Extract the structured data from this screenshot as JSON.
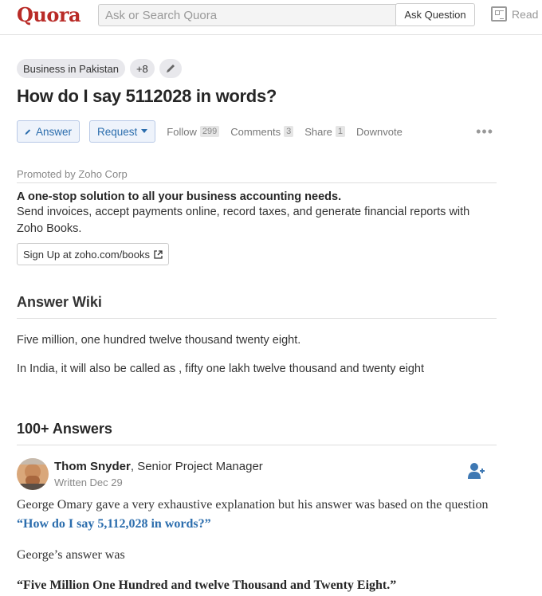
{
  "header": {
    "logo": "Quora",
    "search_placeholder": "Ask or Search Quora",
    "ask_label": "Ask Question",
    "read_label": "Read"
  },
  "topics": {
    "primary": "Business in Pakistan",
    "more": "+8"
  },
  "question": {
    "title": "How do I say 5112028 in words?"
  },
  "actions": {
    "answer_label": "Answer",
    "request_label": "Request",
    "follow_label": "Follow",
    "follow_count": "299",
    "comments_label": "Comments",
    "comments_count": "3",
    "share_label": "Share",
    "share_count": "1",
    "downvote_label": "Downvote",
    "more_label": "•••"
  },
  "promoted": {
    "label": "Promoted by Zoho Corp",
    "headline": "A one-stop solution to all your business accounting needs.",
    "body": "Send invoices, accept payments online, record taxes, and generate financial reports with Zoho Books.",
    "button_label": "Sign Up at zoho.com/books"
  },
  "wiki": {
    "title": "Answer Wiki",
    "line1": "Five million, one hundred twelve thousand twenty eight.",
    "line2": "In India, it will also be called as , fifty one lakh twelve thousand and twenty eight"
  },
  "answers": {
    "count_title": "100+ Answers",
    "author_name": "Thom Snyder",
    "author_credential": ", Senior Project Manager",
    "date": "Written Dec 29",
    "para1_prefix": "George Omary gave a very exhaustive explanation but his answer was based on the question ",
    "para1_link": "“How do I say 5,112,028 in words?”",
    "para2": "George’s answer was",
    "para3": "“Five Million One Hundred and twelve Thousand and Twenty Eight.”"
  },
  "colors": {
    "brand": "#b92b27",
    "link": "#2b6dad"
  }
}
